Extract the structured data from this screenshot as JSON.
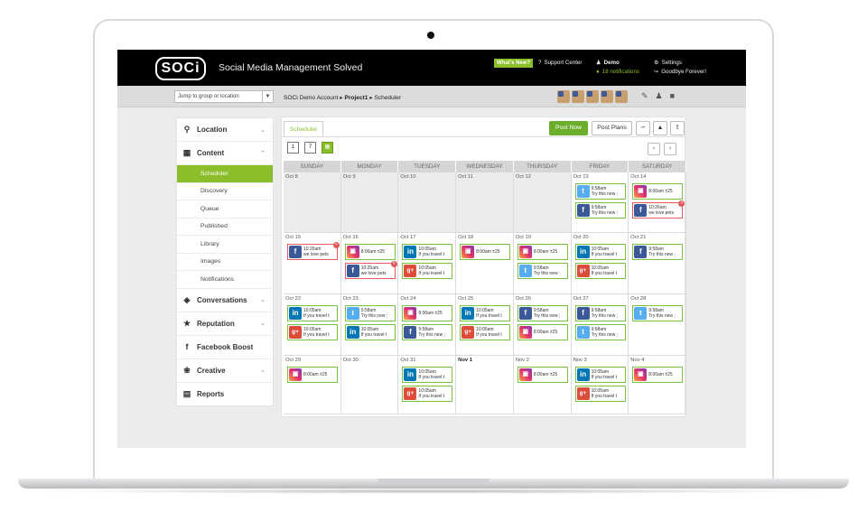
{
  "topbar": {
    "logo_text": "SOCi",
    "tagline": "Social Media Management Solved",
    "whats_new": "What's New?",
    "support": "Support Center",
    "user": "Demo",
    "notifications": "18 notifications",
    "settings": "Settings",
    "logout": "Goodbye Forever!"
  },
  "subheader": {
    "jump_placeholder": "Jump to group or location",
    "breadcrumb_account": "SOCi Demo Account",
    "breadcrumb_project": "Project1",
    "breadcrumb_page": "Scheduler"
  },
  "sidebar": {
    "location": "Location",
    "content": "Content",
    "content_items": [
      "Scheduler",
      "Discovery",
      "Queue",
      "Published",
      "Library",
      "Images",
      "Notifications"
    ],
    "conversations": "Conversations",
    "reputation": "Reputation",
    "facebook_boost": "Facebook Boost",
    "creative": "Creative",
    "reports": "Reports"
  },
  "main": {
    "tab": "Scheduler",
    "post_now": "Post Now",
    "post_plans": "Post Plans",
    "view_day": "1",
    "view_week": "7",
    "view_month_icon": "calendar-month-icon",
    "weekdays": [
      "SUNDAY",
      "MONDAY",
      "TUESDAY",
      "WEDNESDAY",
      "THURSDAY",
      "FRIDAY",
      "SATURDAY"
    ]
  },
  "calendar": [
    [
      {
        "date": "Oct 8",
        "past": true,
        "posts": []
      },
      {
        "date": "Oct 9",
        "past": true,
        "posts": []
      },
      {
        "date": "Oct 10",
        "past": true,
        "posts": []
      },
      {
        "date": "Oct 11",
        "past": true,
        "posts": []
      },
      {
        "date": "Oct 12",
        "past": true,
        "posts": []
      },
      {
        "date": "Oct 13",
        "past": false,
        "posts": [
          {
            "network": "twitter",
            "time": "9:58am",
            "text": "Try this new ;"
          },
          {
            "network": "facebook",
            "time": "9:58am",
            "text": "Try this new ;"
          }
        ]
      },
      {
        "date": "Oct 14",
        "past": false,
        "posts": [
          {
            "network": "instagram",
            "time": "8:00am",
            "text": "±25"
          },
          {
            "network": "facebook",
            "time": "10:26am",
            "text": "we love pets",
            "error": true
          }
        ]
      }
    ],
    [
      {
        "date": "Oct 15",
        "past": false,
        "posts": [
          {
            "network": "facebook",
            "time": "10:26am",
            "text": "we love pets",
            "error": true
          }
        ]
      },
      {
        "date": "Oct 16",
        "past": false,
        "posts": [
          {
            "network": "instagram",
            "time": "8:00am",
            "text": "±25"
          },
          {
            "network": "facebook",
            "time": "10:26am",
            "text": "we love pets",
            "error": true
          }
        ]
      },
      {
        "date": "Oct 17",
        "past": false,
        "posts": [
          {
            "network": "linkedin",
            "time": "10:05am",
            "text": "If you travel t"
          },
          {
            "network": "google",
            "time": "10:05am",
            "text": "If you travel t"
          }
        ]
      },
      {
        "date": "Oct 18",
        "past": false,
        "posts": [
          {
            "network": "instagram",
            "time": "8:00am",
            "text": "±25"
          }
        ]
      },
      {
        "date": "Oct 19",
        "past": false,
        "posts": [
          {
            "network": "instagram",
            "time": "8:00am",
            "text": "±25"
          },
          {
            "network": "twitter",
            "time": "9:58am",
            "text": "Try this new ;"
          }
        ]
      },
      {
        "date": "Oct 20",
        "past": false,
        "posts": [
          {
            "network": "linkedin",
            "time": "10:05am",
            "text": "If you travel t"
          },
          {
            "network": "google",
            "time": "10:05am",
            "text": "If you travel t"
          }
        ]
      },
      {
        "date": "Oct 21",
        "past": false,
        "posts": [
          {
            "network": "facebook",
            "time": "9:58am",
            "text": "Try this new ;"
          }
        ]
      }
    ],
    [
      {
        "date": "Oct 22",
        "past": false,
        "posts": [
          {
            "network": "linkedin",
            "time": "10:05am",
            "text": "If you travel t"
          },
          {
            "network": "google",
            "time": "10:05am",
            "text": "If you travel t"
          }
        ]
      },
      {
        "date": "Oct 23",
        "past": false,
        "posts": [
          {
            "network": "twitter",
            "time": "9:58am",
            "text": "Try this new ;"
          },
          {
            "network": "linkedin",
            "time": "10:05am",
            "text": "If you travel t"
          }
        ]
      },
      {
        "date": "Oct 24",
        "past": false,
        "posts": [
          {
            "network": "instagram",
            "time": "8:00am",
            "text": "±25"
          },
          {
            "network": "facebook",
            "time": "9:58am",
            "text": "Try this new ;"
          }
        ]
      },
      {
        "date": "Oct 25",
        "past": false,
        "posts": [
          {
            "network": "linkedin",
            "time": "10:05am",
            "text": "If you travel t"
          },
          {
            "network": "google",
            "time": "10:05am",
            "text": "If you travel t"
          }
        ]
      },
      {
        "date": "Oct 26",
        "past": false,
        "posts": [
          {
            "network": "facebook",
            "time": "9:58am",
            "text": "Try this new ;"
          },
          {
            "network": "instagram",
            "time": "8:00am",
            "text": "±25"
          }
        ]
      },
      {
        "date": "Oct 27",
        "past": false,
        "posts": [
          {
            "network": "facebook",
            "time": "9:58am",
            "text": "Try this new ;"
          },
          {
            "network": "twitter",
            "time": "9:58am",
            "text": "Try this new ;"
          }
        ]
      },
      {
        "date": "Oct 28",
        "past": false,
        "posts": [
          {
            "network": "twitter",
            "time": "9:58am",
            "text": "Try this new ;"
          }
        ]
      }
    ],
    [
      {
        "date": "Oct 29",
        "past": false,
        "posts": [
          {
            "network": "instagram",
            "time": "8:00am",
            "text": "±25"
          }
        ]
      },
      {
        "date": "Oct 30",
        "past": false,
        "posts": []
      },
      {
        "date": "Oct 31",
        "past": false,
        "posts": [
          {
            "network": "linkedin",
            "time": "10:05am",
            "text": "If you travel t"
          },
          {
            "network": "google",
            "time": "10:05am",
            "text": "If you travel t"
          }
        ]
      },
      {
        "date": "Nov 1",
        "past": false,
        "bold": true,
        "posts": []
      },
      {
        "date": "Nov 2",
        "past": false,
        "posts": [
          {
            "network": "instagram",
            "time": "8:00am",
            "text": "±25"
          }
        ]
      },
      {
        "date": "Nov 3",
        "past": false,
        "posts": [
          {
            "network": "linkedin",
            "time": "10:05am",
            "text": "If you travel t"
          },
          {
            "network": "google",
            "time": "10:05am",
            "text": "If you travel t"
          }
        ]
      },
      {
        "date": "Nov 4",
        "past": false,
        "posts": [
          {
            "network": "instagram",
            "time": "8:00am",
            "text": "±25"
          }
        ]
      }
    ]
  ]
}
